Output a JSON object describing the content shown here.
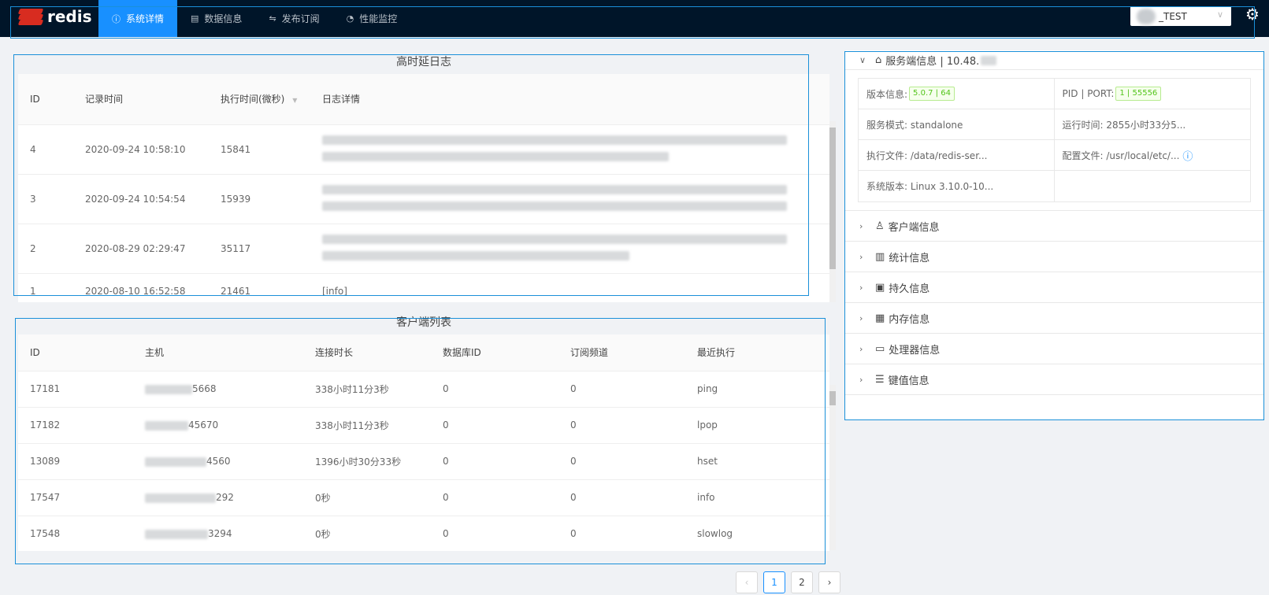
{
  "app": {
    "logo_text": "redis"
  },
  "nav": {
    "items": [
      {
        "label": "系统详情",
        "icon": "ⓘ"
      },
      {
        "label": "数据信息",
        "icon": "▤"
      },
      {
        "label": "发布订阅",
        "icon": "⇋"
      },
      {
        "label": "性能监控",
        "icon": "◔"
      }
    ]
  },
  "env_select": {
    "value": "_TEST",
    "chevron": "∨"
  },
  "settings_icon": "⚙",
  "slowlog": {
    "title": "高时延日志",
    "columns": [
      "ID",
      "记录时间",
      "执行时间(微秒)",
      "日志详情"
    ],
    "sort_icon": "▼",
    "rows": [
      {
        "id": "4",
        "time": "2020-09-24 10:58:10",
        "exec": "15841",
        "detail": ""
      },
      {
        "id": "3",
        "time": "2020-09-24 10:54:54",
        "exec": "15939",
        "detail": ""
      },
      {
        "id": "2",
        "time": "2020-08-29 02:29:47",
        "exec": "35117",
        "detail": ""
      },
      {
        "id": "1",
        "time": "2020-08-10 16:52:58",
        "exec": "21461",
        "detail": "[info]"
      }
    ]
  },
  "clients": {
    "title": "客户端列表",
    "columns": [
      "ID",
      "主机",
      "连接时长",
      "数据库ID",
      "订阅频道",
      "最近执行"
    ],
    "rows": [
      {
        "id": "17181",
        "host": "5668",
        "duration": "338小时11分3秒",
        "db": "0",
        "sub": "0",
        "cmd": "ping"
      },
      {
        "id": "17182",
        "host": "45670",
        "duration": "338小时11分3秒",
        "db": "0",
        "sub": "0",
        "cmd": "lpop"
      },
      {
        "id": "13089",
        "host": "4560",
        "duration": "1396小时30分33秒",
        "db": "0",
        "sub": "0",
        "cmd": "hset"
      },
      {
        "id": "17547",
        "host": "292",
        "duration": "0秒",
        "db": "0",
        "sub": "0",
        "cmd": "info"
      },
      {
        "id": "17548",
        "host": "3294",
        "duration": "0秒",
        "db": "0",
        "sub": "0",
        "cmd": "slowlog"
      }
    ]
  },
  "pagination": {
    "prev": "‹",
    "pages": [
      "1",
      "2"
    ],
    "next": "›",
    "current": "1"
  },
  "server": {
    "header": "服务端信息 | 10.48.",
    "version_label": "版本信息:",
    "version_value": "5.0.7 | 64",
    "pid_label": "PID | PORT:",
    "pid_value": "1 | 55556",
    "mode_text": "服务模式: standalone",
    "uptime_text": "运行时间: 2855小时33分5...",
    "exec_text": "执行文件: /data/redis-ser...",
    "config_text": "配置文件: /usr/local/etc/...",
    "os_text": "系统版本: Linux 3.10.0-10..."
  },
  "sections": [
    {
      "label": "客户端信息",
      "icon": "♙"
    },
    {
      "label": "统计信息",
      "icon": "📊"
    },
    {
      "label": "持久信息",
      "icon": "🗉"
    },
    {
      "label": "内存信息",
      "icon": "▦"
    },
    {
      "label": "处理器信息",
      "icon": "▭"
    },
    {
      "label": "键值信息",
      "icon": "☰"
    }
  ]
}
